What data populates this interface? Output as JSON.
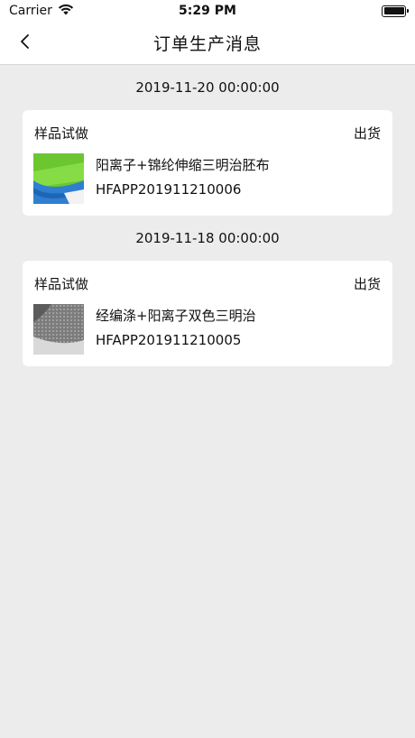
{
  "status_bar": {
    "carrier": "Carrier",
    "time": "5:29 PM",
    "icons": [
      "wifi-icon",
      "battery-icon"
    ]
  },
  "nav": {
    "title": "订单生产消息",
    "back_icon": "chevron-left-icon"
  },
  "messages": [
    {
      "date": "2019-11-20 00:00:00",
      "type": "样品试做",
      "status": "出货",
      "product_name": "阳离子+锦纶伸缩三明治胚布",
      "order_code": "HFAPP201911210006",
      "thumb_colors": [
        "#7ed23a",
        "#2f7fd0"
      ]
    },
    {
      "date": "2019-11-18 00:00:00",
      "type": "样品试做",
      "status": "出货",
      "product_name": "经编涤+阳离子双色三明治",
      "order_code": "HFAPP201911210005",
      "thumb_colors": [
        "#8a8a8a",
        "#d8d8d8"
      ]
    }
  ]
}
